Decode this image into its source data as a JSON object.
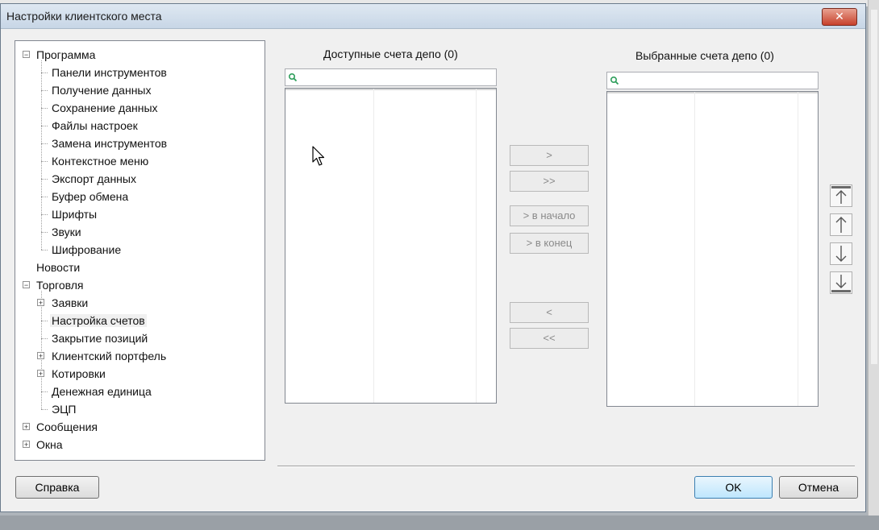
{
  "window": {
    "title": "Настройки клиентского места",
    "close_glyph": "✕"
  },
  "tree": [
    {
      "label": "Программа",
      "level": 0,
      "expander": "minus"
    },
    {
      "label": "Панели инструментов",
      "level": 1
    },
    {
      "label": "Получение данных",
      "level": 1
    },
    {
      "label": "Сохранение данных",
      "level": 1
    },
    {
      "label": "Файлы настроек",
      "level": 1
    },
    {
      "label": "Замена инструментов",
      "level": 1
    },
    {
      "label": "Контекстное меню",
      "level": 1
    },
    {
      "label": "Экспорт данных",
      "level": 1
    },
    {
      "label": "Буфер обмена",
      "level": 1
    },
    {
      "label": "Шрифты",
      "level": 1
    },
    {
      "label": "Звуки",
      "level": 1
    },
    {
      "label": "Шифрование",
      "level": 1
    },
    {
      "label": "Новости",
      "level": 0
    },
    {
      "label": "Торговля",
      "level": 0,
      "expander": "minus"
    },
    {
      "label": "Заявки",
      "level": 1,
      "expander": "plus"
    },
    {
      "label": "Настройка счетов",
      "level": 1,
      "selected": true
    },
    {
      "label": "Закрытие позиций",
      "level": 1
    },
    {
      "label": "Клиентский портфель",
      "level": 1,
      "expander": "plus"
    },
    {
      "label": "Котировки",
      "level": 1,
      "expander": "plus"
    },
    {
      "label": "Денежная единица",
      "level": 1
    },
    {
      "label": "ЭЦП",
      "level": 1
    },
    {
      "label": "Сообщения",
      "level": 0,
      "expander": "plus"
    },
    {
      "label": "Окна",
      "level": 0,
      "expander": "plus"
    }
  ],
  "available": {
    "title": "Доступные счета депо (0)",
    "search_value": ""
  },
  "selected_list": {
    "title": "Выбранные счета депо (0)",
    "search_value": ""
  },
  "transfer_buttons": {
    "add": ">",
    "add_all": ">>",
    "add_to_start": "> в начало",
    "add_to_end": "> в конец",
    "remove": "<",
    "remove_all": "<<"
  },
  "order_buttons": [
    "move-top",
    "move-up",
    "move-down",
    "move-bottom"
  ],
  "footer": {
    "help": "Справка",
    "ok": "OK",
    "cancel": "Отмена"
  },
  "colors": {
    "accent": "#3c7fb1",
    "close": "#c7412b",
    "search_icon": "#2e9e5b"
  }
}
